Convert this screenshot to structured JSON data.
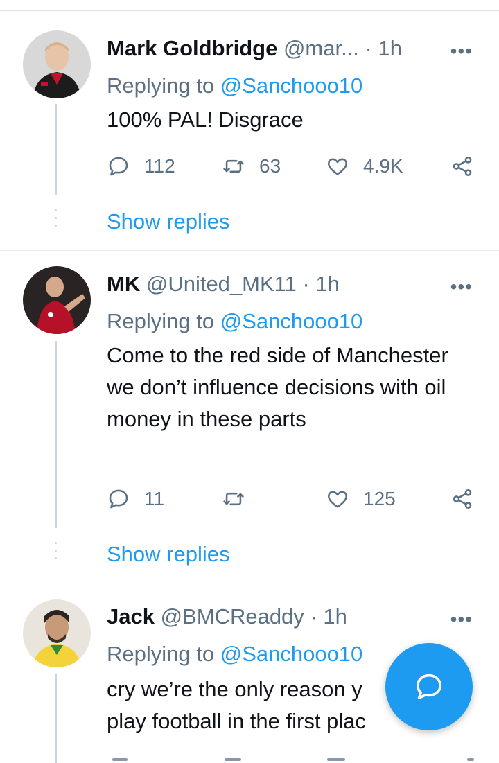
{
  "tweets": [
    {
      "name": "Mark Goldbridge",
      "handle": "@mar...",
      "time": "· 1h",
      "replying_prefix": "Replying to ",
      "replying_to": "@Sanchooo10",
      "text": "100% PAL! Disgrace",
      "replies": "112",
      "retweets": "63",
      "likes": "4.9K",
      "show_replies": "Show replies"
    },
    {
      "name": "MK",
      "handle": "@United_MK11",
      "time": "· 1h",
      "replying_prefix": "Replying to ",
      "replying_to": "@Sanchooo10",
      "text": "Come to the red side of Manchester we don’t influence decisions with oil money in these parts",
      "replies": "11",
      "retweets": "",
      "likes": "125",
      "show_replies": "Show replies"
    },
    {
      "name": "Jack",
      "handle": "@BMCReaddy",
      "time": "· 1h",
      "replying_prefix": "Replying to ",
      "replying_to": "@Sanchooo10",
      "text": "cry we’re the only reason y play football in the first plac"
    }
  ],
  "more_label": "•••",
  "icons": {
    "reply": "reply-icon",
    "retweet": "retweet-icon",
    "like": "heart-icon",
    "share": "share-icon",
    "compose": "compose-reply-icon"
  },
  "colors": {
    "accent": "#1d9bf0",
    "secondary_text": "#5b7083",
    "primary_text": "#0f1419"
  }
}
